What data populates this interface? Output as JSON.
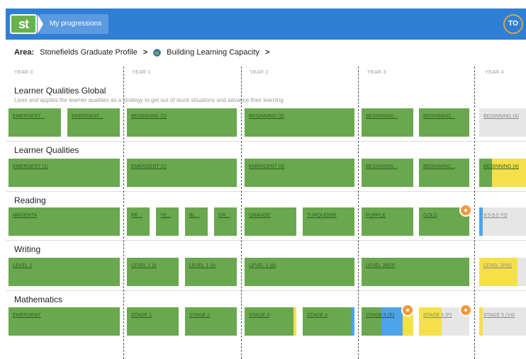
{
  "header": {
    "logo_text": "st",
    "nav_label": "My progressions",
    "user_initials": "TO",
    "accent": "#2f7fd6"
  },
  "breadcrumb": {
    "area_label": "Area:",
    "item1": "Stonefields Graduate Profile",
    "sep": ">",
    "item2": "Building Learning Capacity",
    "icon": "globe-icon"
  },
  "years": [
    "YEAR 0",
    "YEAR 1",
    "YEAR 2",
    "YEAR 3",
    "YEAR 4"
  ],
  "sections": [
    {
      "title": "Learner Qualities Global",
      "description": "Lives and applies the learner qualities as a strategy to get out of stuck situations and advance their learning",
      "blocks": [
        "EMERGENT...",
        "EMERGENT...",
        "BEGINNING (2)",
        "BEGINNING (3)",
        "BEGINNING...",
        "BEGINNING...",
        "BEGINNING (4)"
      ]
    },
    {
      "title": "Learner Qualities",
      "description": "",
      "blocks": [
        "EMERGENT (1)",
        "EMERGENT (2)",
        "EMERGENT (3)",
        "BEGINNING...",
        "BEGINNING...",
        "BEGINNING (4)"
      ]
    },
    {
      "title": "Reading",
      "description": "",
      "blocks": [
        "MAGENTA",
        "RE...",
        "YE...",
        "BL...",
        "GR...",
        "ORANGE",
        "TURQUOISE",
        "PURPLE",
        "GOLD",
        "9.5-9.5 YO"
      ]
    },
    {
      "title": "Writing",
      "description": "",
      "blocks": [
        "LEVEL 1",
        "LEVEL 1 (i)",
        "LEVEL 1 (ii)",
        "LEVEL 1 (iii)",
        "LEVEL 2BSP",
        "LEVEL 2P(ii)"
      ]
    },
    {
      "title": "Mathematics",
      "description": "",
      "blocks": [
        "EMERGENT",
        "STAGE 1",
        "STAGE 2",
        "STAGE 3",
        "STAGE 4",
        "STAGE 5 (E)",
        "STAGE 5 (P)",
        "STAGE 5 (Y4)"
      ]
    }
  ],
  "colors": {
    "achieved": "#6aa84f",
    "in_progress": "#4fa3e8",
    "partial": "#f5e04a",
    "not_started": "#e6e6e6",
    "flag": "#f29a3a"
  }
}
